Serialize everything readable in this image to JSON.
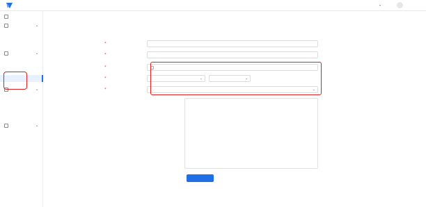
{
  "app": {
    "brand": "",
    "brand_sub": ""
  },
  "topbar": {
    "help": "",
    "user": ""
  },
  "breadcrumb": "",
  "page_title": "",
  "sidebar": {
    "groups": [
      {
        "label": ""
      },
      {
        "label": "",
        "items": [
          {
            "label": ""
          },
          {
            "label": ""
          }
        ]
      },
      {
        "label": "",
        "items": [
          {
            "label": ""
          },
          {
            "label": ""
          },
          {
            "label": ""
          }
        ]
      },
      {
        "label": "",
        "items": [
          {
            "label": ""
          },
          {
            "label": ""
          },
          {
            "label": ""
          }
        ]
      },
      {
        "label": "",
        "items": [
          {
            "label": ""
          }
        ]
      }
    ]
  },
  "form": {
    "fields": [
      {
        "label": "",
        "placeholder": ""
      },
      {
        "label": "",
        "placeholder": ""
      },
      {
        "label": "",
        "ph_start": "",
        "ph_end": ""
      },
      {
        "label": "",
        "ph_a": "",
        "ph_b": ""
      },
      {
        "label": "",
        "placeholder": ""
      },
      {
        "label": ""
      }
    ],
    "message_lines": [
      "",
      "",
      "",
      "",
      "",
      "",
      "",
      "",
      "",
      "",
      "",
      "",
      "",
      "",
      "",
      ""
    ]
  },
  "buttons": {
    "primary": "",
    "reset": ""
  },
  "watermark": ""
}
